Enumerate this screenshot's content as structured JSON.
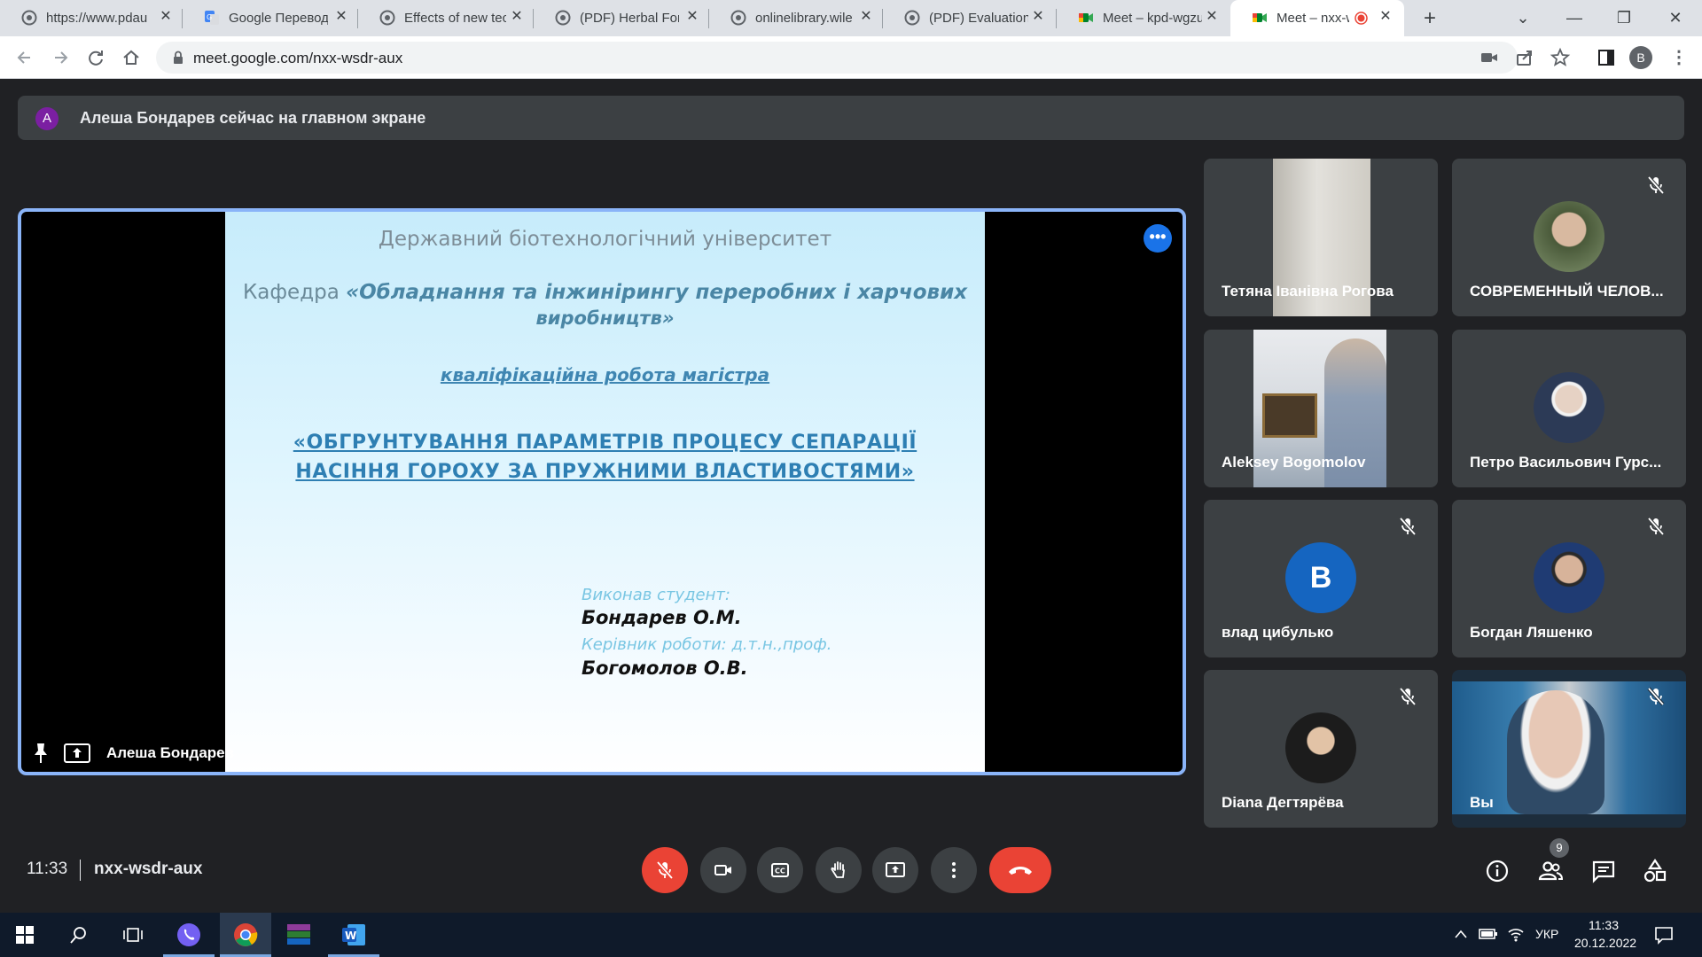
{
  "browser": {
    "tabs": [
      {
        "title": "https://www.pdau",
        "icon": "globe-icon"
      },
      {
        "title": "Google Перевод",
        "icon": "translate-icon"
      },
      {
        "title": "Effects of new tec",
        "icon": "globe-icon"
      },
      {
        "title": "(PDF) Herbal Forti",
        "icon": "globe-icon"
      },
      {
        "title": "onlinelibrary.wiley",
        "icon": "globe-icon"
      },
      {
        "title": "(PDF) Evaluation o",
        "icon": "globe-icon"
      },
      {
        "title": "Meet – kpd-wgzu",
        "icon": "meet-icon"
      },
      {
        "title": "Meet – nxx-w",
        "icon": "meet-icon"
      }
    ],
    "url": "meet.google.com/nxx-wsdr-aux",
    "profile_initial": "B"
  },
  "banner": {
    "avatar_initial": "A",
    "text": "Алеша Бондарев сейчас на главном экране"
  },
  "main": {
    "presenter": "Алеша Бондарев",
    "slide": {
      "university": "Державний біотехнологічний університет",
      "department_prefix": "Кафедра",
      "department_line1": "«Обладнання та інжинірингу переробних і харчових",
      "department_line2": "виробництв»",
      "work_type": "кваліфікаційна робота магістра",
      "topic_line1": "«ОБГРУНТУВАННЯ ПАРАМЕТРІВ ПРОЦЕСУ СЕПАРАЦІЇ",
      "topic_line2": "НАСІННЯ ГОРОХУ ЗА ПРУЖНИМИ ВЛАСТИВОСТЯМИ»",
      "student_label": "Виконав студент:",
      "student_name": "Бондарев О.М.",
      "supervisor_label": "Керівник роботи: д.т.н.,проф.",
      "supervisor_name": "Богомолов О.В."
    }
  },
  "participants": [
    {
      "name": "Тетяна Іванівна Рогова",
      "muted": false
    },
    {
      "name": "СОВРЕМЕННЫЙ ЧЕЛОВ...",
      "muted": true
    },
    {
      "name": "Aleksey Bogomolov",
      "muted": false
    },
    {
      "name": "Петро Васильович Гурс...",
      "muted": false
    },
    {
      "name": "влад цибулько",
      "muted": true,
      "avatar_letter": "В"
    },
    {
      "name": "Богдан Ляшенко",
      "muted": true
    },
    {
      "name": "Diana Дегтярёва",
      "muted": true
    },
    {
      "name": "Вы",
      "muted": true
    }
  ],
  "bottom": {
    "time": "11:33",
    "meeting_code": "nxx-wsdr-aux",
    "participant_count": "9"
  },
  "taskbar": {
    "language": "УКР",
    "time": "11:33",
    "date": "20.12.2022"
  },
  "colors": {
    "accent": "#8ab4f8",
    "end_call": "#ea4335",
    "meet_bg": "#202124",
    "tile_bg": "#3c4043"
  }
}
